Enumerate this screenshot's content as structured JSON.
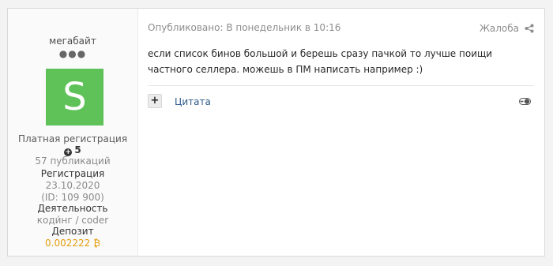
{
  "author": {
    "username": "мегабайт",
    "rank_dots": "●●●",
    "avatar_letter": "S",
    "avatar_color": "#5ec258",
    "group": "Платная регистрация",
    "reputation": "5",
    "posts": "57 публикаций",
    "registration_label": "Регистрация",
    "registration_date": "23.10.2020",
    "user_id": "(ID: 109 900)",
    "activity_label": "Деятельность",
    "activity_value": "коди́нг / coder",
    "deposit_label": "Депозит",
    "deposit_value": "0.002222 ₿"
  },
  "post": {
    "published": "Опубликовано: В понедельник в 10:16",
    "report_label": "Жалоба",
    "text": "если список бинов большой и берешь сразу пачкой то лучше поищи частного селлера. можешь в ПМ написать например :)",
    "plus_label": "+",
    "quote_label": "Цитата"
  },
  "colors": {
    "accent_link": "#2d5a8a",
    "deposit": "#e39d0c"
  },
  "icons": {
    "share": "share-icon",
    "reputation": "plus-circle-icon",
    "reactions": "reaction-toggle-icon"
  }
}
